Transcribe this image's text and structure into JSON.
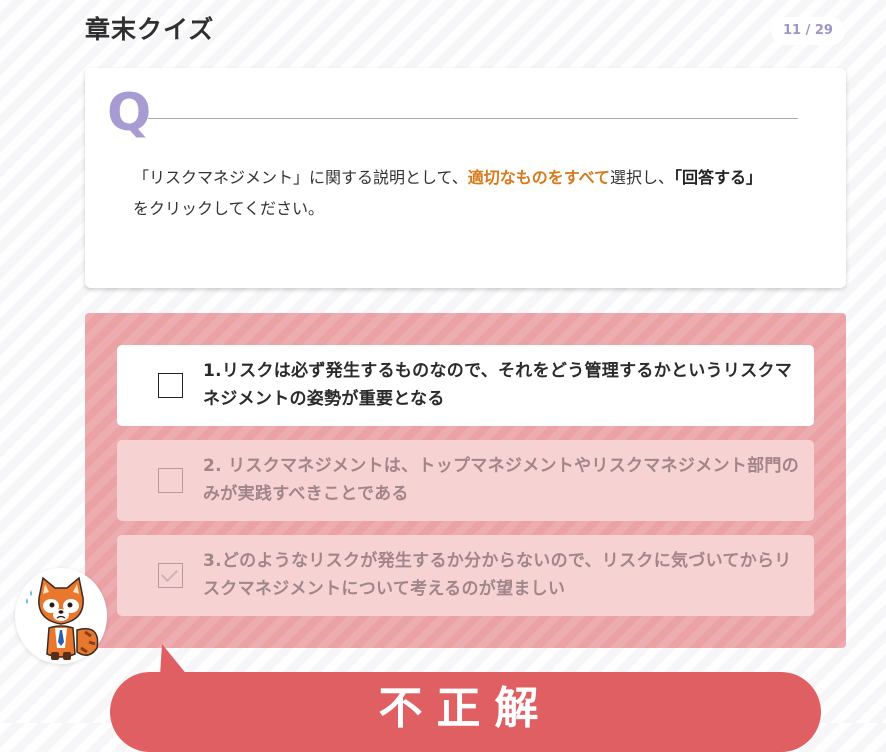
{
  "header": {
    "title": "章末クイズ",
    "counter": "11 / 29"
  },
  "question": {
    "letter": "Q",
    "text_part1": "「リスクマネジメント」に関する説明として、",
    "text_highlight": "適切なものをすべて",
    "text_part2": "選択し、",
    "text_bold": "「回答する」",
    "text_part3": "をクリックしてください。"
  },
  "options": [
    {
      "label": "1.リスクは必ず発生するものなので、それをどう管理するかというリスクマネジメントの姿勢が重要となる",
      "checked": false
    },
    {
      "label": "2. リスクマネジメントは、トップマネジメントやリスクマネジメント部門のみが実践すべきことである",
      "checked": false
    },
    {
      "label": "3.どのようなリスクが発生するか分からないので、リスクに気づいてからリスクマネジメントについて考えるのが望ましい",
      "checked": true
    }
  ],
  "result": {
    "label": "不正解"
  },
  "colors": {
    "accent": "#a79bd1",
    "highlight": "#d9791a",
    "incorrect": "#df5f62",
    "answer_panel": "#eba2a5"
  },
  "icons": {
    "mascot": "red-panda-mascot-icon",
    "checkbox": "checkbox-icon",
    "check": "check-icon"
  }
}
